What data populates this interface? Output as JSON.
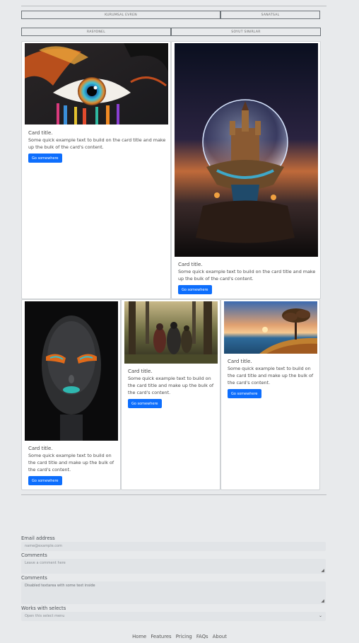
{
  "nav_buttons": {
    "row1": [
      "Kurumsal Evren",
      "Sanatsal"
    ],
    "row2": [
      "Rasyonel",
      "Soyut Sınırlar"
    ]
  },
  "cards": [
    {
      "title": "Card title.",
      "text": "Some quick example text to build on the card title and make up the bulk of the card's content.",
      "button": "Go somewhere"
    },
    {
      "title": "Card title.",
      "text": "Some quick example text to build on the card title and make up the bulk of the card's content.",
      "button": "Go somewhere"
    },
    {
      "title": "Card title.",
      "text": "Some quick example text to build on the card title and make up the bulk of the card's content.",
      "button": "Go somewhere"
    },
    {
      "title": "Card title.",
      "text": "Some quick example text to build on the card title and make up the bulk of the card's content.",
      "button": "Go somewhere"
    },
    {
      "title": "Card title.",
      "text": "Some quick example text to build on the card title and make up the bulk of the card's content.",
      "button": "Go somewhere"
    }
  ],
  "form": {
    "email_label": "Email address",
    "email_placeholder": "name@example.com",
    "comments_label": "Comments",
    "comments_placeholder": "Leave a comment here",
    "comments2_label": "Comments",
    "comments2_value": "Disabled textarea with some text inside",
    "select_label": "Works with selects",
    "select_value": "Open this select menu"
  },
  "footer": [
    "Home",
    "Features",
    "Pricing",
    "FAQs",
    "About"
  ],
  "colors": {
    "accent": "#0d6efd",
    "background": "#e8eaec"
  }
}
